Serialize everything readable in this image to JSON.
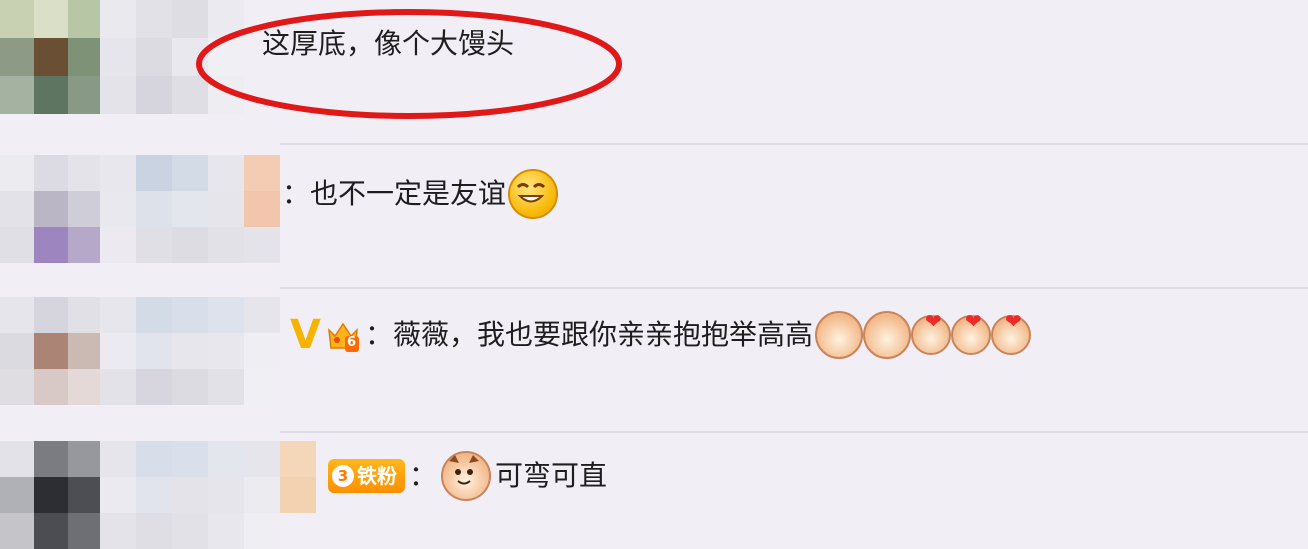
{
  "comments": [
    {
      "text": "这厚底，像个大馒头",
      "highlighted": true
    },
    {
      "prefix": "：",
      "text": "也不一定是友谊",
      "emoji": "smirk-emoji"
    },
    {
      "badge": "V",
      "crown_level": "6",
      "prefix": "：",
      "text": "薇薇，我也要跟你亲亲抱抱举高高",
      "stickers": [
        "cat-kiss-sticker",
        "cat-kiss-sticker",
        "cat-heart-sticker",
        "cat-heart-sticker",
        "cat-heart-sticker"
      ]
    },
    {
      "fan_level": "3",
      "fan_label": "铁粉",
      "prefix": "：",
      "sticker": "cat-face-sticker",
      "text": "可弯可直"
    }
  ],
  "colors": {
    "background": "#f1eff5",
    "highlight_ring": "#e01818",
    "badge_gold": "#f6b300"
  }
}
